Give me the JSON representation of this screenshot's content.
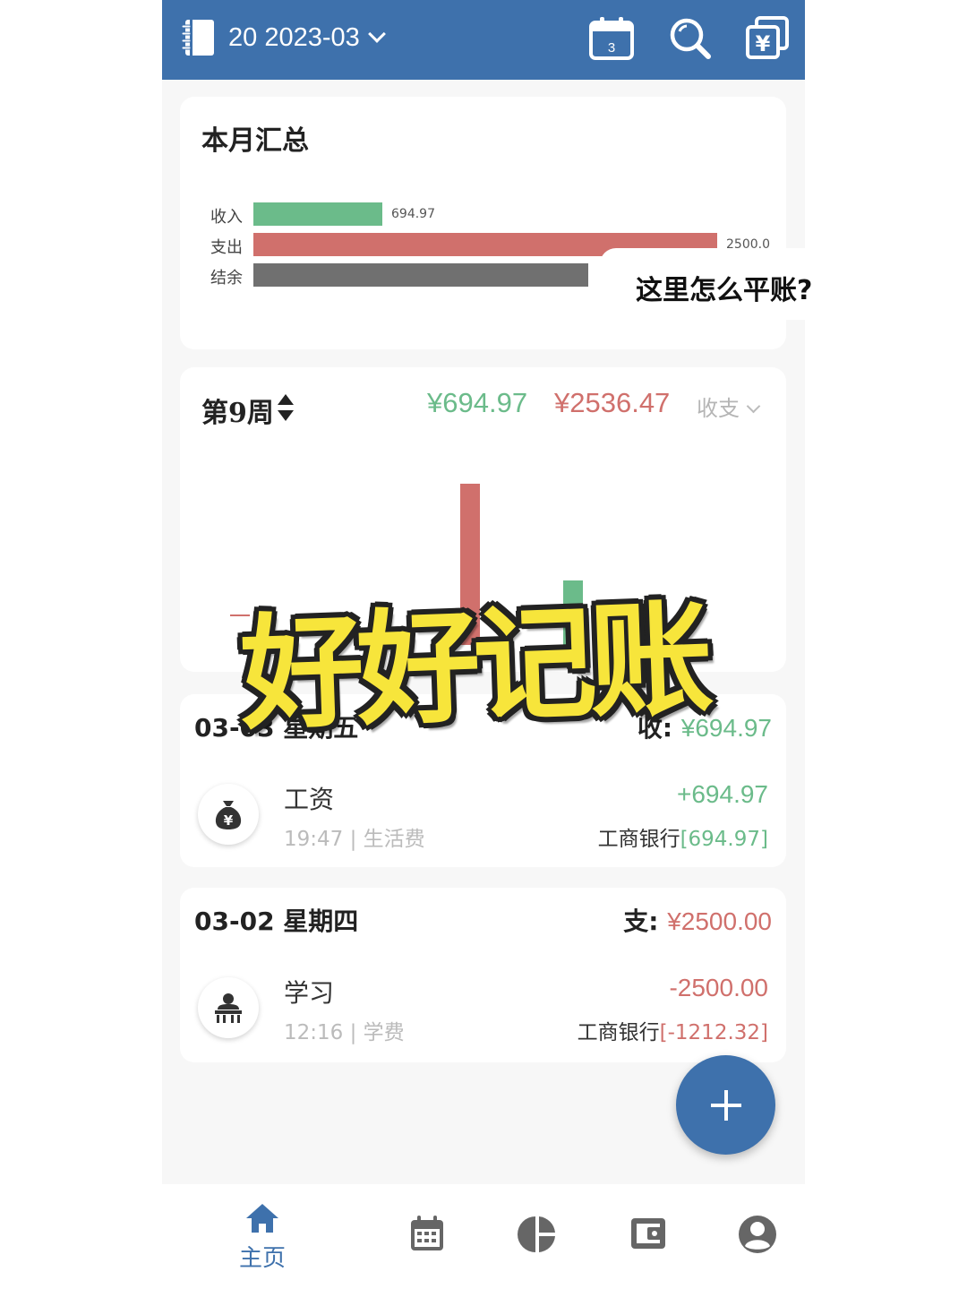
{
  "header": {
    "title": "20 2023-03",
    "calendar_day": "3"
  },
  "summary": {
    "title": "本月汇总",
    "rows": [
      {
        "label": "收入",
        "value": "694.97",
        "color": "#6bbb8a"
      },
      {
        "label": "支出",
        "value": "2500.0",
        "color": "#d0706c"
      },
      {
        "label": "结余",
        "value": "",
        "color": "#707070"
      }
    ]
  },
  "week": {
    "title": "第9周",
    "income": "¥694.97",
    "expense": "¥2536.47",
    "filter_label": "收支"
  },
  "days": [
    {
      "date": "03-03 星期五",
      "total_label": "收:",
      "total_amount": "¥694.97",
      "transactions": [
        {
          "icon": "money-bag-icon",
          "name": "工资",
          "time": "19:47",
          "tag": "生活费",
          "amount": "+694.97",
          "account": "工商银行",
          "balance": "[694.97]"
        }
      ]
    },
    {
      "date": "03-02 星期四",
      "total_label": "支:",
      "total_amount": "¥2500.00",
      "transactions": [
        {
          "icon": "student-icon",
          "name": "学习",
          "time": "12:16",
          "tag": "学费",
          "amount": "-2500.00",
          "account": "工商银行",
          "balance": "[-1212.32]"
        }
      ]
    }
  ],
  "bottom_nav": {
    "home_label": "主页"
  },
  "overlay": {
    "bubble": "这里怎么平账?",
    "title": "好好记账"
  },
  "colors": {
    "primary": "#3e71ac",
    "income": "#6bbb8a",
    "expense": "#d0706c",
    "balance": "#707070"
  }
}
